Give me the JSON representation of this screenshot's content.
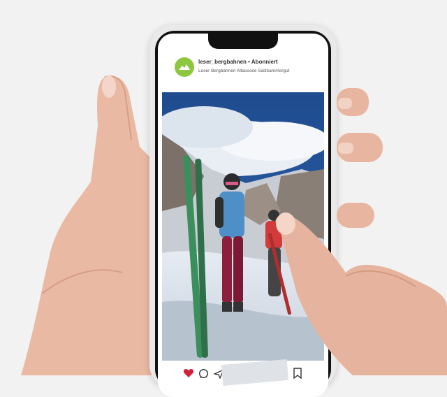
{
  "post": {
    "username": "leser_bergbahnen",
    "separator": "•",
    "follow_status": "Abonniert",
    "location": "Loser Bergbahnen Altaussee Salzkammergut"
  },
  "colors": {
    "avatar": "#8dc63f",
    "like": "#d0233a"
  },
  "icons": [
    "heart-icon",
    "comment-icon",
    "share-icon",
    "bookmark-icon"
  ]
}
